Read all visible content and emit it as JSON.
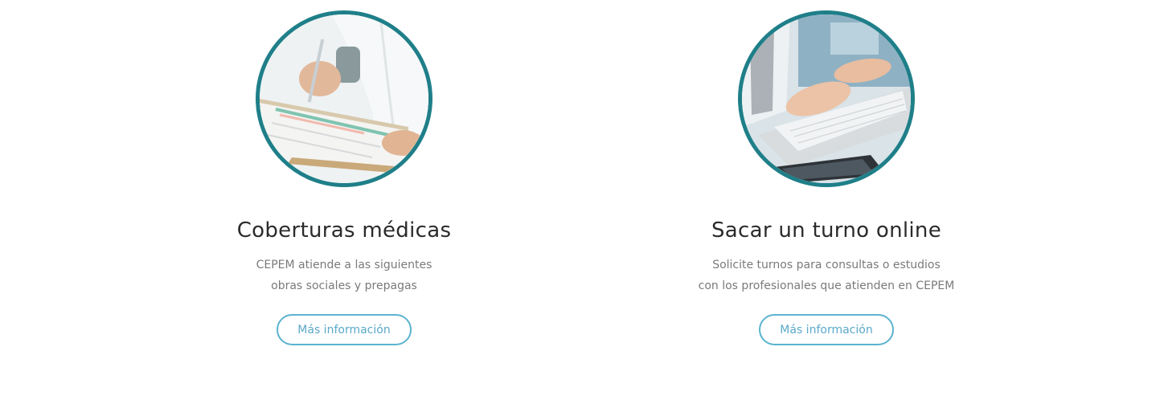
{
  "cards": [
    {
      "image_name": "doctor-clipboard-photo",
      "title": "Coberturas médicas",
      "desc_line1": "CEPEM atiende a las siguientes",
      "desc_line2": "obras sociales y prepagas",
      "button_label": "Más información"
    },
    {
      "image_name": "laptop-typing-photo",
      "title": "Sacar un turno online",
      "desc_line1": "Solicite turnos para consultas o estudios",
      "desc_line2": "con los profesionales que atienden en CEPEM",
      "button_label": "Más información"
    }
  ],
  "colors": {
    "ring": "#1f7f89",
    "button_border": "#5bb3cf",
    "button_text": "#5aa9c8",
    "title_text": "#2b2b2b",
    "desc_text": "#7a7a7a"
  }
}
